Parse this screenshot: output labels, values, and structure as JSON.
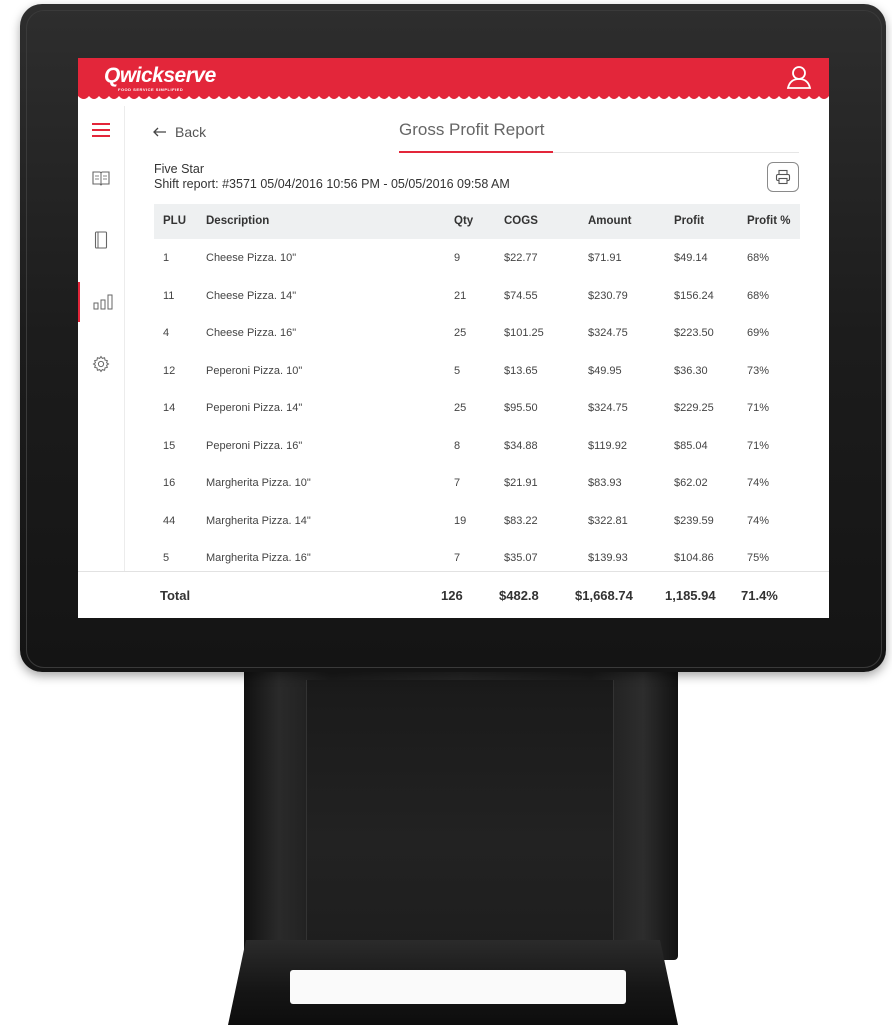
{
  "app": {
    "brand": "Qwickserve",
    "tagline": "FOOD SERVICE SIMPLIFIED",
    "accent_color": "#e3263a"
  },
  "sidebar": {
    "items": [
      {
        "icon": "hamburger-menu-icon",
        "active": false
      },
      {
        "icon": "menu-book-icon",
        "active": false
      },
      {
        "icon": "notebook-icon",
        "active": false
      },
      {
        "icon": "bar-chart-icon",
        "active": true
      },
      {
        "icon": "gear-icon",
        "active": false
      }
    ]
  },
  "header": {
    "back_label": "Back",
    "title": "Gross Profit Report"
  },
  "report": {
    "store_name": "Five Star",
    "shift_info": "Shift report: #3571 05/04/2016 10:56 PM - 05/05/2016 09:58 AM"
  },
  "table": {
    "columns": [
      "PLU",
      "Description",
      "Qty",
      "COGS",
      "Amount",
      "Profit",
      "Profit %"
    ],
    "rows": [
      [
        "1",
        "Cheese Pizza. 10\"",
        "9",
        "$22.77",
        "$71.91",
        "$49.14",
        "68%"
      ],
      [
        "11",
        "Cheese Pizza. 14\"",
        "21",
        "$74.55",
        "$230.79",
        "$156.24",
        "68%"
      ],
      [
        "4",
        "Cheese Pizza. 16\"",
        "25",
        "$101.25",
        "$324.75",
        "$223.50",
        "69%"
      ],
      [
        "12",
        "Peperoni Pizza. 10\"",
        "5",
        "$13.65",
        "$49.95",
        "$36.30",
        "73%"
      ],
      [
        "14",
        "Peperoni Pizza. 14\"",
        "25",
        "$95.50",
        "$324.75",
        "$229.25",
        "71%"
      ],
      [
        "15",
        "Peperoni Pizza. 16\"",
        "8",
        "$34.88",
        "$119.92",
        "$85.04",
        "71%"
      ],
      [
        "16",
        "Margherita Pizza. 10\"",
        "7",
        "$21.91",
        "$83.93",
        "$62.02",
        "74%"
      ],
      [
        "44",
        "Margherita Pizza. 14\"",
        "19",
        "$83.22",
        "$322.81",
        "$239.59",
        "74%"
      ],
      [
        "5",
        "Margherita Pizza. 16\"",
        "7",
        "$35.07",
        "$139.93",
        "$104.86",
        "75%"
      ]
    ],
    "total": {
      "label": "Total",
      "qty": "126",
      "cogs": "$482.8",
      "amount": "$1,668.74",
      "profit": "1,185.94",
      "profit_pct": "71.4%"
    }
  }
}
